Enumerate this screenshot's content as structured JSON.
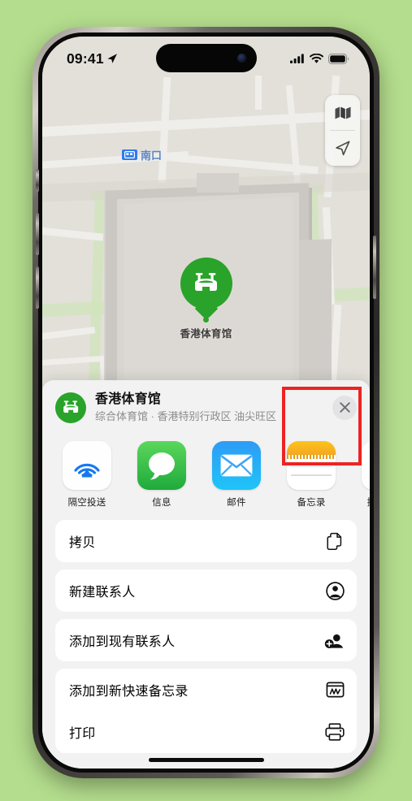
{
  "background_color": "#b4dd8d",
  "status_bar": {
    "time": "09:41",
    "location_arrow": "location-arrow-icon",
    "cellular": "cellular-signal-icon",
    "wifi": "wifi-icon",
    "battery": "battery-icon"
  },
  "map": {
    "transit_label": "南口",
    "transit_badge": "subway-badge-icon",
    "pin_label": "香港体育馆",
    "pin_icon": "stadium-icon",
    "controls": [
      {
        "name": "map-type-button",
        "icon": "folded-map-icon"
      },
      {
        "name": "locate-me-button",
        "icon": "location-arrow-icon"
      }
    ]
  },
  "share_sheet": {
    "place_title": "香港体育馆",
    "place_subtitle": "综合体育馆 · 香港特别行政区 油尖旺区",
    "place_icon": "stadium-icon",
    "close_icon": "close-icon",
    "apps": [
      {
        "label": "隔空投送",
        "icon": "airdrop-icon",
        "highlighted": false
      },
      {
        "label": "信息",
        "icon": "messages-icon",
        "highlighted": false
      },
      {
        "label": "邮件",
        "icon": "mail-icon",
        "highlighted": false
      },
      {
        "label": "备忘录",
        "icon": "notes-icon",
        "highlighted": true
      },
      {
        "label": "提醒事项",
        "icon": "reminders-icon",
        "highlighted": false
      }
    ],
    "actions": [
      {
        "label": "拷贝",
        "icon": "copy-icon"
      },
      {
        "label": "新建联系人",
        "icon": "new-contact-icon"
      },
      {
        "label": "添加到现有联系人",
        "icon": "add-to-contact-icon"
      },
      {
        "label": "添加到新快速备忘录",
        "icon": "quick-note-icon"
      },
      {
        "label": "打印",
        "icon": "printer-icon"
      }
    ],
    "highlight_color": "#ee2222"
  }
}
